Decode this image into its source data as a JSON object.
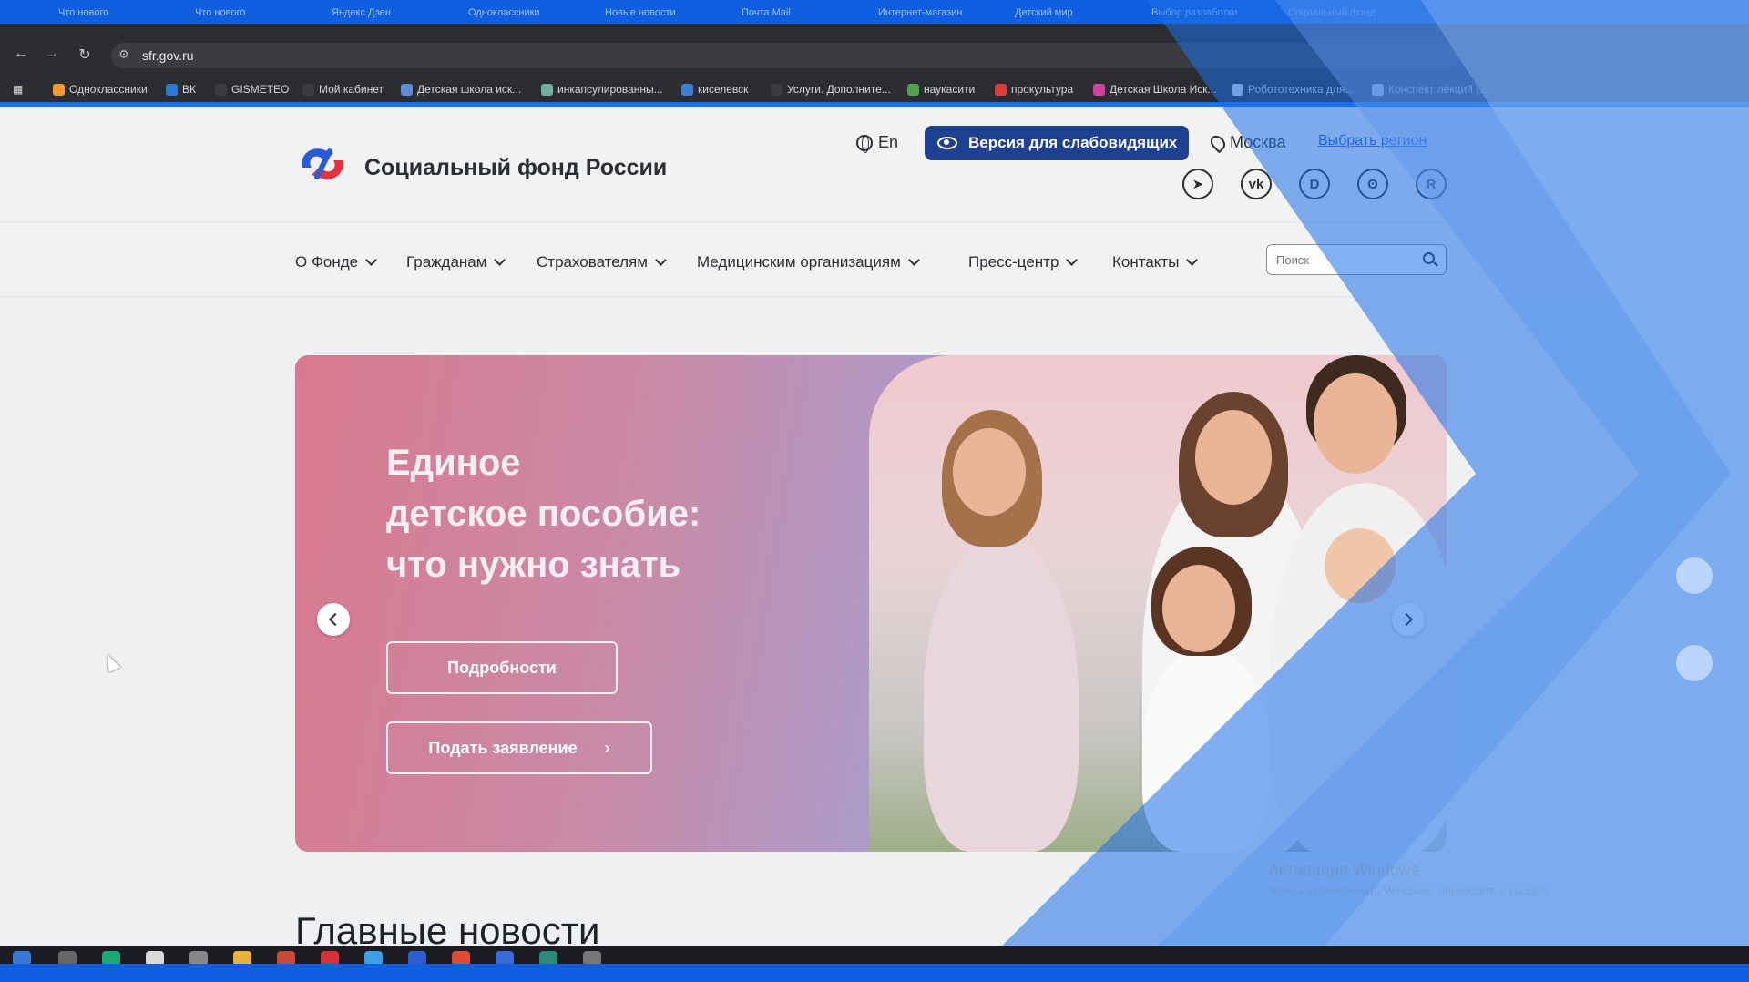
{
  "browser": {
    "tabs": [
      "Что нового",
      "Что нового",
      "Яндекс Дзен",
      "Одноклассники",
      "Новые новости",
      "Почта Mail",
      "Интернет-магазин",
      "Детский мир",
      "Выбор разработки",
      "Социальный фонд"
    ],
    "url": "sfr.gov.ru",
    "bookmarks": [
      "Одноклассники",
      "ВК",
      "GISMETEO",
      "Мой кабинет",
      "Детская школа иск...",
      "инкапсулированны...",
      "киселевск",
      "Услуги. Дополните...",
      "наукасити",
      "прокультура",
      "Детская Школа Иск...",
      "Робототехника для...",
      "Конспект лекций |..."
    ]
  },
  "header": {
    "site_title": "Социальный фонд России",
    "lang_label": "En",
    "vision_label": "Версия для слабовидящих",
    "city": "Москва",
    "region_link": "Выбрать регион",
    "social": [
      "telegram-icon",
      "vk-icon",
      "dzen-icon",
      "ok-icon",
      "rutube-icon"
    ]
  },
  "menu": {
    "items": [
      "О Фонде",
      "Гражданам",
      "Страхователям",
      "Медицинским организациям",
      "Пресс-центр",
      "Контакты"
    ],
    "search_placeholder": "Поиск"
  },
  "banner": {
    "title_lines": [
      "Единое",
      "детское  пособие:",
      "что нужно знать"
    ],
    "details_button": "Подробности",
    "apply_button": "Подать заявление"
  },
  "news": {
    "heading": "Главные новости"
  },
  "watermark": {
    "line1": "Активация Windows",
    "line2": "Чтобы активировать Windows, перейдите в раздел"
  },
  "colors": {
    "accent": "#1f3f8f",
    "link": "#2f5bd4",
    "logo_blue": "#2a5bd7",
    "logo_red": "#e6323c"
  }
}
